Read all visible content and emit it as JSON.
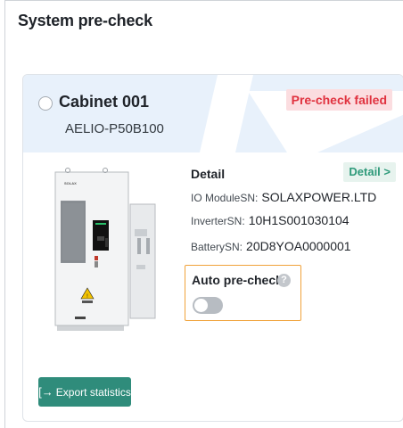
{
  "page": {
    "title": "System pre-check"
  },
  "cabinet": {
    "name": "Cabinet 001",
    "model": "AELIO-P50B100",
    "status": "Pre-check failed",
    "brand_label": "SOLAX"
  },
  "detail": {
    "title": "Detail",
    "link_label": "Detail >",
    "rows": [
      {
        "label": "IO ModuleSN:",
        "value": "SOLAXPOWER.LTD"
      },
      {
        "label": "InverterSN:",
        "value": "10H1S001030104"
      },
      {
        "label": "BatterySN:",
        "value": "20D8YOA0000001"
      }
    ]
  },
  "auto_precheck": {
    "label": "Auto pre-check",
    "help_glyph": "?",
    "enabled": false
  },
  "export": {
    "icon_glyph": "[→",
    "label": "Export statistics"
  },
  "colors": {
    "failed_text": "#e0323f",
    "failed_bg": "#fbdde0",
    "accent_green": "#2f8c7b",
    "highlight_orange": "#f0a23a",
    "header_bg": "#e8f1fb"
  }
}
